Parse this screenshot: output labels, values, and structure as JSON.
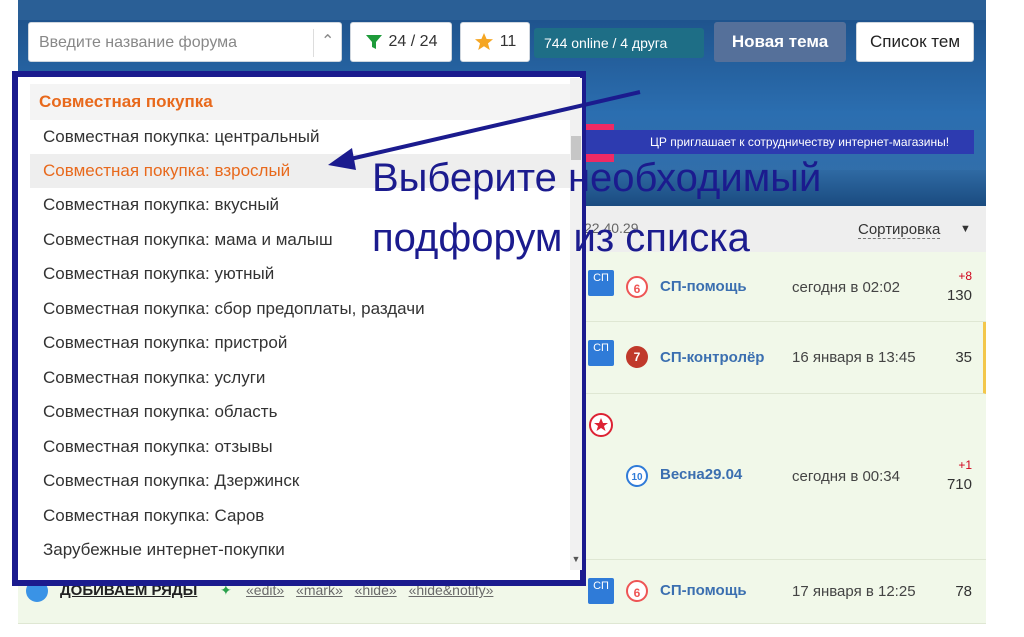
{
  "search": {
    "placeholder": "Введите название форума"
  },
  "filter": {
    "label": "24 / 24"
  },
  "favorites": {
    "count": "11"
  },
  "online": {
    "text": "744 online  / 4 друга"
  },
  "buttons": {
    "new_topic": "Новая тема",
    "topic_list": "Список тем"
  },
  "banner": {
    "text": "ЦР приглашает к сотрудничеству интернет-магазины!"
  },
  "list": {
    "sort_label": "Сортировка",
    "timeframe": "22.40.29",
    "rows": [
      {
        "author": "СП-помощь",
        "level": "6",
        "time": "сегодня в 02:02",
        "delta": "+8",
        "count": "130"
      },
      {
        "author": "СП-контролёр",
        "level": "7",
        "time": "16 января в 13:45",
        "delta": "",
        "count": "35"
      },
      {
        "author": "Весна29.04",
        "level": "10",
        "time": "сегодня в 00:34",
        "delta": "+1",
        "count": "710"
      },
      {
        "author": "СП-помощь",
        "level": "6",
        "time": "17 января в 12:25",
        "delta": "",
        "count": "78"
      }
    ],
    "bottom_row": {
      "title": "ДОБИВАЕМ РЯДЫ",
      "links": [
        "«edit»",
        "«mark»",
        "«hide»",
        "«hide&notify»"
      ]
    }
  },
  "dropdown": {
    "group": "Совместная покупка",
    "items": [
      "Совместная покупка: центральный",
      "Совместная покупка: взрослый",
      "Совместная покупка: вкусный",
      "Совместная покупка: мама и малыш",
      "Совместная покупка: уютный",
      "Совместная покупка: сбор предоплаты, раздачи",
      "Совместная покупка: пристрой",
      "Совместная покупка: услуги",
      "Совместная покупка: область",
      "Совместная покупка: отзывы",
      "Совместная покупка: Дзержинск",
      "Совместная покупка: Саров",
      "Зарубежные интернет-покупки"
    ],
    "active_index": 1
  },
  "annotation": {
    "line1": "Выберите необходимый",
    "line2": "подфорум из списка"
  },
  "colors": {
    "accent_orange": "#e8691c",
    "frame_navy": "#1b1b8e",
    "online_bg": "#1e6e86",
    "new_topic_bg": "#55709a"
  }
}
